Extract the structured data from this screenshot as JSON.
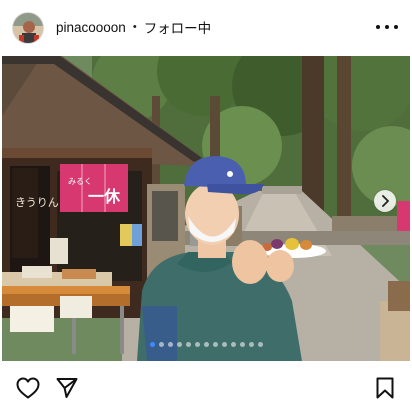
{
  "post": {
    "username": "pinacoooon",
    "separator": "•",
    "follow_status": "フォロー中"
  },
  "photo": {
    "banner_text": "一休",
    "banner_small": "みるく",
    "shop_sign_text": "きうりん",
    "carousel": {
      "total": 13,
      "active_index": 0
    }
  },
  "icons": {
    "avatar": "avatar",
    "more": "more-horizontal-icon",
    "next": "chevron-right-icon",
    "like": "heart-icon",
    "share": "paper-plane-icon",
    "save": "bookmark-icon"
  }
}
